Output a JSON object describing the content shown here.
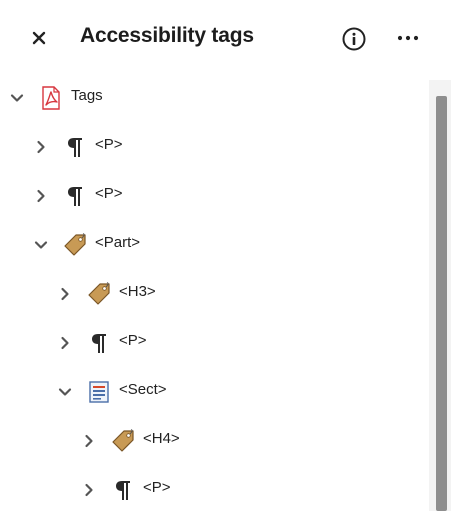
{
  "header": {
    "title": "Accessibility tags",
    "close_icon": "close-icon",
    "info_icon": "info-icon",
    "more_icon": "more-options-icon"
  },
  "tree": {
    "items": [
      {
        "label": "Tags",
        "icon": "pdf-document-icon",
        "expanded": true
      },
      {
        "label": "<P>",
        "icon": "paragraph-icon",
        "expanded": false
      },
      {
        "label": "<P>",
        "icon": "paragraph-icon",
        "expanded": false
      },
      {
        "label": "<Part>",
        "icon": "tag-icon",
        "expanded": true
      },
      {
        "label": "<H3>",
        "icon": "tag-icon",
        "expanded": false
      },
      {
        "label": "<P>",
        "icon": "paragraph-icon",
        "expanded": false
      },
      {
        "label": "<Sect>",
        "icon": "section-icon",
        "expanded": true
      },
      {
        "label": "<H4>",
        "icon": "tag-icon",
        "expanded": false
      },
      {
        "label": "<P>",
        "icon": "paragraph-icon",
        "expanded": false
      }
    ]
  },
  "colors": {
    "text": "#222222",
    "pdf_red": "#d7373f",
    "tag_brown": "#b8894a",
    "scroll_thumb": "#8e8e8e",
    "scroll_track": "#f3f3f3"
  }
}
